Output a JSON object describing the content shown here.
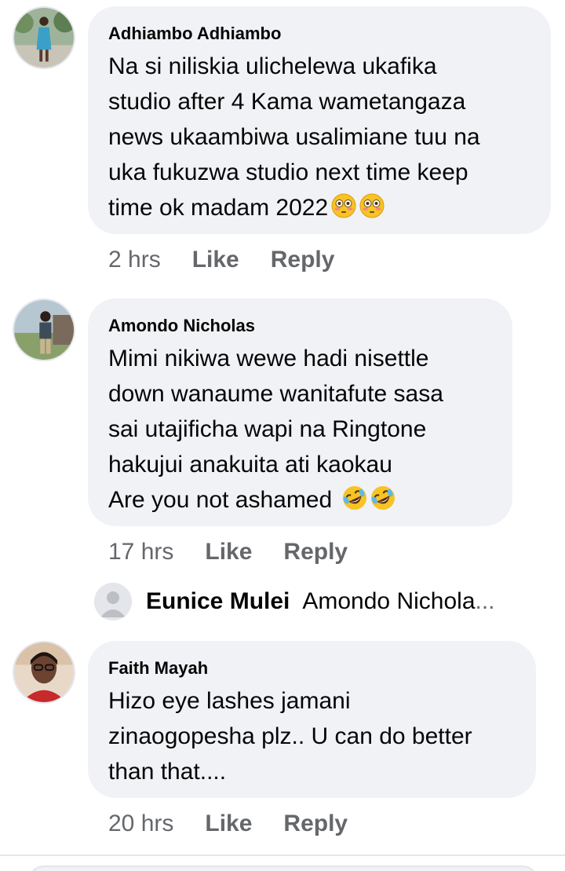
{
  "comments": [
    {
      "author": "Adhiambo Adhiambo",
      "text": "Na si niliskia ulichelewa ukafika\nstudio after 4 Kama wametangaza\nnews ukaambiwa usalimiane tuu na\nuka fukuzwa studio next time keep\ntime ok madam 2022",
      "emoji": [
        "flushed-face-icon",
        "flushed-face-icon"
      ],
      "time": "2 hrs",
      "like_label": "Like",
      "reply_label": "Reply"
    },
    {
      "author": "Amondo Nicholas",
      "text": "Mimi nikiwa wewe hadi nisettle\ndown wanaume wanitafute sasa\nsai utajificha wapi na Ringtone\nhakujui anakuita ati kaokau\nAre you not ashamed ",
      "emoji": [
        "rolling-laughing-face-icon",
        "rolling-laughing-face-icon"
      ],
      "time": "17 hrs",
      "like_label": "Like",
      "reply_label": "Reply",
      "reply_preview": {
        "name": "Eunice Mulei",
        "snippet": "Amondo Nichola",
        "ellipsis": "...",
        "avatar_icon": "default-avatar-icon"
      }
    },
    {
      "author": "Faith Mayah",
      "text": "Hizo eye lashes jamani\nzinaogopesha plz.. U can do better\nthan that....",
      "emoji": [],
      "time": "20 hrs",
      "like_label": "Like",
      "reply_label": "Reply"
    }
  ],
  "colors": {
    "bubble": "#f0f2f5",
    "secondary_text": "#65676b",
    "primary_text": "#050505"
  }
}
